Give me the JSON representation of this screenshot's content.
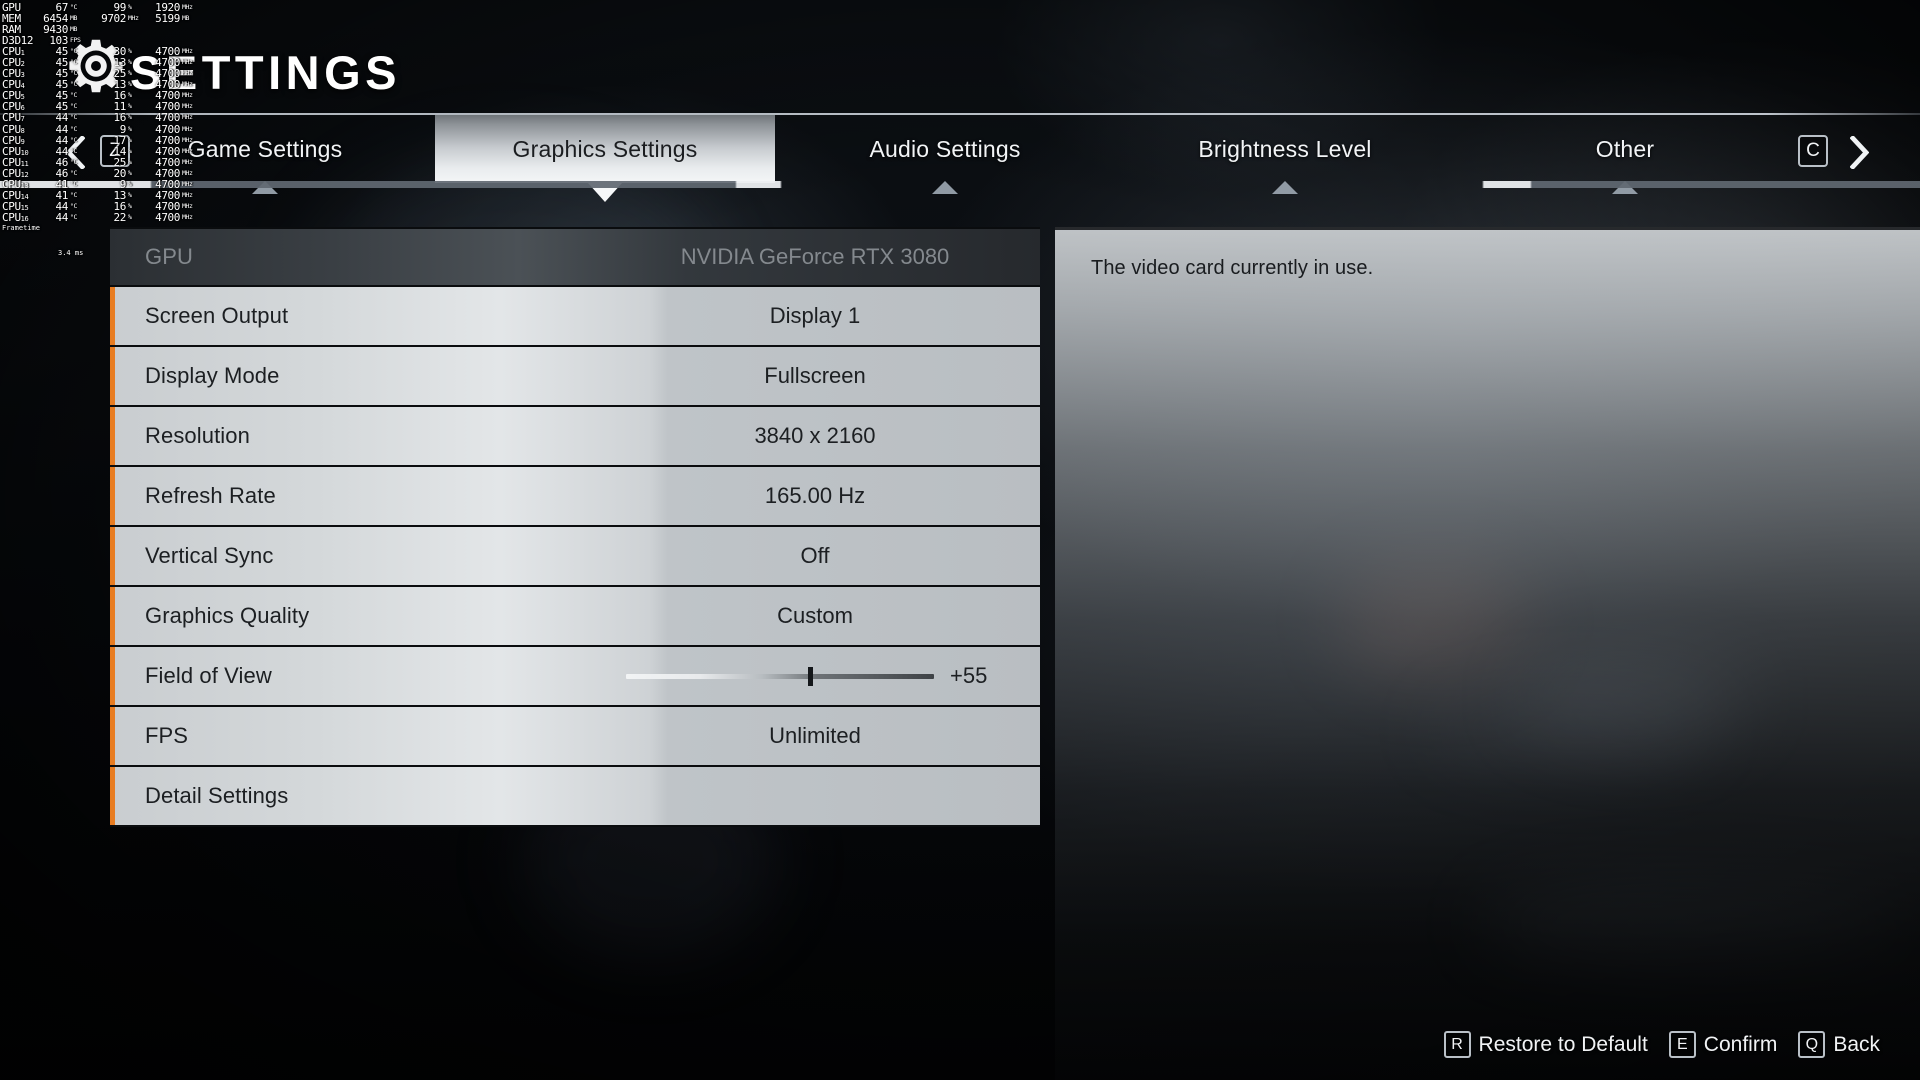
{
  "header": {
    "title": "SETTINGS",
    "gear_icon": "gear-icon"
  },
  "tabbar": {
    "prev_key": "Z",
    "next_key": "C",
    "prev_icon": "chevron-left-icon",
    "next_icon": "chevron-right-icon",
    "active_index": 1,
    "tabs": [
      {
        "label": "Game Settings"
      },
      {
        "label": "Graphics Settings"
      },
      {
        "label": "Audio Settings"
      },
      {
        "label": "Brightness Level"
      },
      {
        "label": "Other"
      }
    ]
  },
  "settings": {
    "rows": [
      {
        "label": "GPU",
        "value": "NVIDIA GeForce RTX 3080",
        "type": "text",
        "disabled": true
      },
      {
        "label": "Screen Output",
        "value": "Display 1",
        "type": "text",
        "disabled": false
      },
      {
        "label": "Display Mode",
        "value": "Fullscreen",
        "type": "text",
        "disabled": false
      },
      {
        "label": "Resolution",
        "value": "3840 x 2160",
        "type": "text",
        "disabled": false
      },
      {
        "label": "Refresh Rate",
        "value": "165.00 Hz",
        "type": "text",
        "disabled": false
      },
      {
        "label": "Vertical Sync",
        "value": "Off",
        "type": "text",
        "disabled": false
      },
      {
        "label": "Graphics Quality",
        "value": "Custom",
        "type": "text",
        "disabled": false
      },
      {
        "label": "Field of View",
        "value": "+55",
        "type": "slider",
        "disabled": false,
        "slider_percent": 59
      },
      {
        "label": "FPS",
        "value": "Unlimited",
        "type": "text",
        "disabled": false
      },
      {
        "label": "Detail Settings",
        "value": "",
        "type": "submenu",
        "disabled": false
      }
    ]
  },
  "description": {
    "text": "The video card currently in use."
  },
  "hints": [
    {
      "key": "R",
      "label": "Restore to Default"
    },
    {
      "key": "E",
      "label": "Confirm"
    },
    {
      "key": "Q",
      "label": "Back"
    }
  ],
  "perf_overlay": {
    "rows": [
      {
        "label": "GPU",
        "sub": "",
        "v1": "67",
        "u1": "°C",
        "v2": "99",
        "u2": "%",
        "v3": "1920",
        "u3": "MHz"
      },
      {
        "label": "MEM",
        "sub": "",
        "v1": "6454",
        "u1": "MB",
        "v2": "9702",
        "u2": "MHz",
        "v3": "5199",
        "u3": "MB"
      },
      {
        "label": "RAM",
        "sub": "",
        "v1": "9430",
        "u1": "MB",
        "v2": "",
        "u2": "",
        "v3": "",
        "u3": ""
      },
      {
        "label": "D3D12",
        "sub": "",
        "v1": "103",
        "u1": "FPS",
        "v2": "",
        "u2": "",
        "v3": "",
        "u3": ""
      },
      {
        "label": "CPU",
        "sub": "1",
        "v1": "45",
        "u1": "°C",
        "v2": "30",
        "u2": "%",
        "v3": "4700",
        "u3": "MHz"
      },
      {
        "label": "CPU",
        "sub": "2",
        "v1": "45",
        "u1": "°C",
        "v2": "13",
        "u2": "%",
        "v3": "4700",
        "u3": "MHz"
      },
      {
        "label": "CPU",
        "sub": "3",
        "v1": "45",
        "u1": "°C",
        "v2": "25",
        "u2": "%",
        "v3": "4700",
        "u3": "MHz"
      },
      {
        "label": "CPU",
        "sub": "4",
        "v1": "45",
        "u1": "°C",
        "v2": "13",
        "u2": "%",
        "v3": "4700",
        "u3": "MHz"
      },
      {
        "label": "CPU",
        "sub": "5",
        "v1": "45",
        "u1": "°C",
        "v2": "16",
        "u2": "%",
        "v3": "4700",
        "u3": "MHz"
      },
      {
        "label": "CPU",
        "sub": "6",
        "v1": "45",
        "u1": "°C",
        "v2": "11",
        "u2": "%",
        "v3": "4700",
        "u3": "MHz"
      },
      {
        "label": "CPU",
        "sub": "7",
        "v1": "44",
        "u1": "°C",
        "v2": "16",
        "u2": "%",
        "v3": "4700",
        "u3": "MHz"
      },
      {
        "label": "CPU",
        "sub": "8",
        "v1": "44",
        "u1": "°C",
        "v2": "9",
        "u2": "%",
        "v3": "4700",
        "u3": "MHz"
      },
      {
        "label": "CPU",
        "sub": "9",
        "v1": "44",
        "u1": "°C",
        "v2": "17",
        "u2": "%",
        "v3": "4700",
        "u3": "MHz"
      },
      {
        "label": "CPU",
        "sub": "10",
        "v1": "44",
        "u1": "°C",
        "v2": "14",
        "u2": "%",
        "v3": "4700",
        "u3": "MHz"
      },
      {
        "label": "CPU",
        "sub": "11",
        "v1": "46",
        "u1": "°C",
        "v2": "25",
        "u2": "%",
        "v3": "4700",
        "u3": "MHz"
      },
      {
        "label": "CPU",
        "sub": "12",
        "v1": "46",
        "u1": "°C",
        "v2": "20",
        "u2": "%",
        "v3": "4700",
        "u3": "MHz"
      },
      {
        "label": "CPU",
        "sub": "13",
        "v1": "41",
        "u1": "°C",
        "v2": "9",
        "u2": "%",
        "v3": "4700",
        "u3": "MHz"
      },
      {
        "label": "CPU",
        "sub": "14",
        "v1": "41",
        "u1": "°C",
        "v2": "13",
        "u2": "%",
        "v3": "4700",
        "u3": "MHz"
      },
      {
        "label": "CPU",
        "sub": "15",
        "v1": "44",
        "u1": "°C",
        "v2": "16",
        "u2": "%",
        "v3": "4700",
        "u3": "MHz"
      },
      {
        "label": "CPU",
        "sub": "16",
        "v1": "44",
        "u1": "°C",
        "v2": "22",
        "u2": "%",
        "v3": "4700",
        "u3": "MHz"
      }
    ],
    "frametime_label": "Frametime",
    "frametime_scale": "3.4 ms"
  },
  "colors": {
    "accent_orange": "#e87d22",
    "row_text": "#1c1f22",
    "tab_text": "#f2f4f6",
    "overlay_text": "#ffffff"
  }
}
